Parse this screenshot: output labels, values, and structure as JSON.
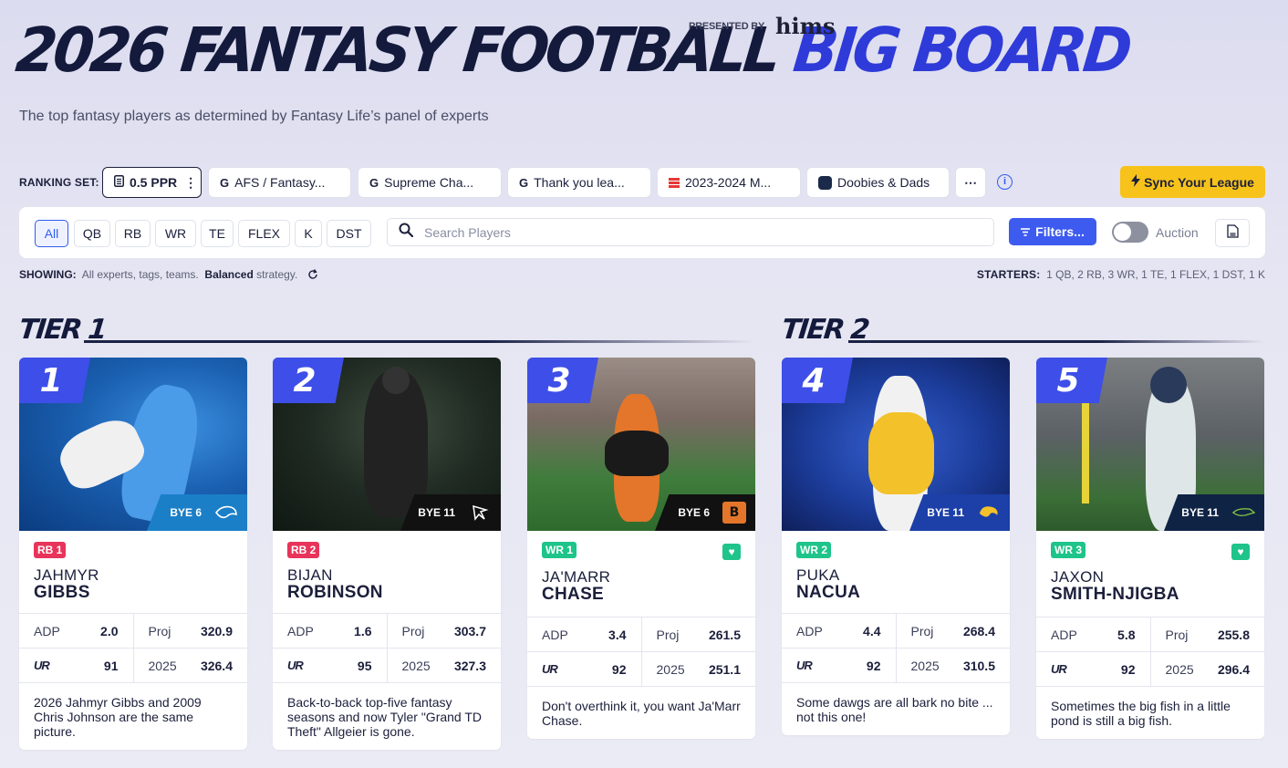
{
  "header": {
    "title_main": "2026 FANTASY FOOTBALL ",
    "title_accent": "BIG BOARD",
    "presented_by": "PRESENTED BY",
    "sponsor": "hims",
    "subtitle": "The top fantasy players as determined by Fantasy Life’s panel of experts"
  },
  "ranking_set": {
    "label": "RANKING SET:",
    "active": "0.5 PPR",
    "leagues": [
      "AFS / Fantasy...",
      "Supreme Cha...",
      "Thank you lea...",
      "2023-2024 M...",
      "Doobies & Dads"
    ],
    "more": "⋯",
    "sync_label": "Sync Your League"
  },
  "filters": {
    "positions": [
      "All",
      "QB",
      "RB",
      "WR",
      "TE",
      "FLEX",
      "K",
      "DST"
    ],
    "active_position": "All",
    "search_placeholder": "Search Players",
    "filters_label": "Filters...",
    "auction_label": "Auction",
    "auction_on": false
  },
  "showing": {
    "label": "SHOWING:",
    "text1": "All experts, tags, teams.",
    "strategy": "Balanced",
    "text2": "strategy."
  },
  "starters": {
    "label": "STARTERS:",
    "value": "1 QB, 2 RB, 3 WR, 1 TE, 1 FLEX, 1 DST, 1 K"
  },
  "tiers": [
    {
      "label": "TIER 1"
    },
    {
      "label": "TIER 2"
    }
  ],
  "players": [
    {
      "rank": "1",
      "bye": "BYE 6",
      "team_color": "#1b7fc8",
      "position": "RB 1",
      "pos_color": "#e8345a",
      "heart": false,
      "first": "JAHMYR",
      "last": "GIBBS",
      "adp_label": "ADP",
      "adp": "2.0",
      "proj_label": "Proj",
      "proj": "320.9",
      "ur_label": "UR",
      "ur": "91",
      "prev_label": "2025",
      "prev": "326.4",
      "blurb": "2026 Jahmyr Gibbs and 2009 Chris Johnson are the same picture."
    },
    {
      "rank": "2",
      "bye": "BYE 11",
      "team_color": "#111111",
      "position": "RB 2",
      "pos_color": "#e8345a",
      "heart": false,
      "first": "BIJAN",
      "last": "ROBINSON",
      "adp_label": "ADP",
      "adp": "1.6",
      "proj_label": "Proj",
      "proj": "303.7",
      "ur_label": "UR",
      "ur": "95",
      "prev_label": "2025",
      "prev": "327.3",
      "blurb": "Back-to-back top-five fantasy seasons and now Tyler \"Grand TD Theft\" Allgeier is gone."
    },
    {
      "rank": "3",
      "bye": "BYE 6",
      "team_color": "#111111",
      "position": "WR 1",
      "pos_color": "#1ec48a",
      "heart": true,
      "first": "JA'MARR",
      "last": "CHASE",
      "adp_label": "ADP",
      "adp": "3.4",
      "proj_label": "Proj",
      "proj": "261.5",
      "ur_label": "UR",
      "ur": "92",
      "prev_label": "2025",
      "prev": "251.1",
      "blurb": "Don't overthink it, you want Ja'Marr Chase."
    },
    {
      "rank": "4",
      "bye": "BYE 11",
      "team_color": "#1c3fa8",
      "position": "WR 2",
      "pos_color": "#1ec48a",
      "heart": false,
      "first": "PUKA",
      "last": "NACUA",
      "adp_label": "ADP",
      "adp": "4.4",
      "proj_label": "Proj",
      "proj": "268.4",
      "ur_label": "UR",
      "ur": "92",
      "prev_label": "2025",
      "prev": "310.5",
      "blurb": "Some dawgs are all bark no bite ... not this one!"
    },
    {
      "rank": "5",
      "bye": "BYE 11",
      "team_color": "#0f2344",
      "position": "WR 3",
      "pos_color": "#1ec48a",
      "heart": true,
      "first": "JAXON",
      "last": "SMITH-NJIGBA",
      "adp_label": "ADP",
      "adp": "5.8",
      "proj_label": "Proj",
      "proj": "255.8",
      "ur_label": "UR",
      "ur": "92",
      "prev_label": "2025",
      "prev": "296.4",
      "blurb": "Sometimes the big fish in a little pond is still a big fish."
    }
  ],
  "colors": {
    "accent": "#3e4ee8",
    "sync": "#f7c21a",
    "filters": "#3e5bf0",
    "rb": "#e8345a",
    "wr": "#1ec48a"
  },
  "icons": [
    "sheet-icon",
    "google-icon",
    "espn-icon",
    "helmet-icon",
    "info-icon",
    "bolt-icon",
    "search-icon",
    "filter-icon",
    "export-icon",
    "refresh-icon",
    "heart-icon"
  ]
}
